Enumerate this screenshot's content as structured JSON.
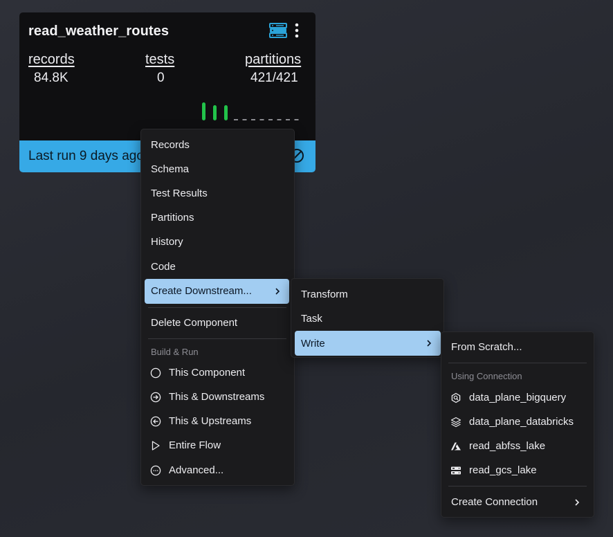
{
  "card": {
    "title": "read_weather_routes",
    "stats": [
      {
        "label": "records",
        "value": "84.8K"
      },
      {
        "label": "tests",
        "value": "0"
      },
      {
        "label": "partitions",
        "value": "421/421"
      }
    ],
    "status_text": "Last run 9 days ago",
    "status_color": "#36a9e6",
    "accent_icon_color": "#2ba3d8",
    "spark_success_color": "#22c24a",
    "spark_success_runs": 3,
    "spark_empty_runs": 8
  },
  "menu": {
    "items": [
      {
        "label": "Records"
      },
      {
        "label": "Schema"
      },
      {
        "label": "Test Results"
      },
      {
        "label": "Partitions"
      },
      {
        "label": "History"
      },
      {
        "label": "Code"
      },
      {
        "label": "Create Downstream..."
      },
      {
        "label": "Delete Component"
      }
    ],
    "build_run_header": "Build & Run",
    "build_run_items": [
      {
        "label": "This Component",
        "icon": "circle-icon"
      },
      {
        "label": "This & Downstreams",
        "icon": "arrow-right-circle-icon"
      },
      {
        "label": "This & Upstreams",
        "icon": "arrow-left-circle-icon"
      },
      {
        "label": "Entire Flow",
        "icon": "play-icon"
      },
      {
        "label": "Advanced...",
        "icon": "more-circle-icon"
      }
    ],
    "highlight_color": "#a2cdf2"
  },
  "submenu": {
    "items": [
      {
        "label": "Transform"
      },
      {
        "label": "Task"
      },
      {
        "label": "Write"
      }
    ]
  },
  "write_menu": {
    "from_scratch": "From Scratch...",
    "connection_header": "Using Connection",
    "connections": [
      {
        "label": "data_plane_bigquery",
        "icon": "bigquery-icon"
      },
      {
        "label": "data_plane_databricks",
        "icon": "databricks-icon"
      },
      {
        "label": "read_abfss_lake",
        "icon": "azure-icon"
      },
      {
        "label": "read_gcs_lake",
        "icon": "gcs-server-icon"
      }
    ],
    "create_connection": "Create Connection"
  }
}
